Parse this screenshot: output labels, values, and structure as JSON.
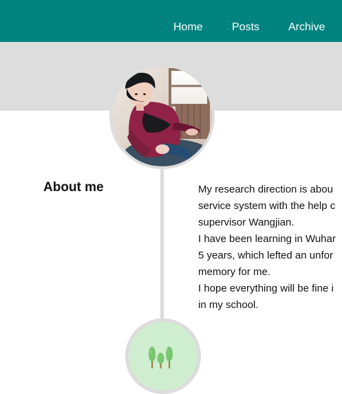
{
  "colors": {
    "header": "#00837f",
    "banner": "#dddddd",
    "timeline": "#dcdcdc",
    "trees_circle_bg": "#cfeecf"
  },
  "nav": {
    "items": [
      {
        "label": "Home"
      },
      {
        "label": "Posts"
      },
      {
        "label": "Archive"
      }
    ]
  },
  "avatar": {
    "icon": "avatar-photo"
  },
  "about": {
    "title": "About me",
    "lines": [
      "My research direction is abou",
      "service system with the help c",
      "supervisor Wangjian.",
      "I have been learning in Wuhar",
      "5 years, which lefted an unfor",
      "memory for me.",
      "I hope everything will be fine i",
      "in my school."
    ]
  },
  "timeline_end": {
    "icon": "trees-icon"
  }
}
